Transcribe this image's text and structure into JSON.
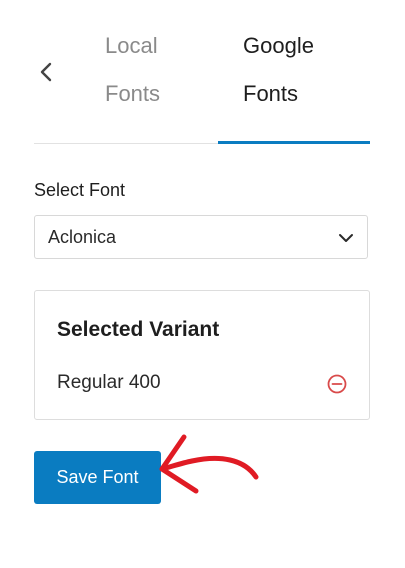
{
  "tabs": [
    {
      "line1": "Local",
      "line2": "Fonts",
      "active": false
    },
    {
      "line1": "Google",
      "line2": "Fonts",
      "active": true
    }
  ],
  "icons": {
    "back": "chevron-left-icon",
    "select": "chevron-down-icon",
    "remove": "minus-circle-icon",
    "annotation": "arrow-annotation-icon"
  },
  "select_font": {
    "label": "Select Font",
    "value": "Aclonica"
  },
  "selected_variant": {
    "title": "Selected Variant",
    "variants": [
      "Regular 400"
    ]
  },
  "save_button": {
    "label": "Save Font"
  },
  "colors": {
    "accent": "#0a7cc1",
    "remove": "#d94a4a",
    "annotation_arrow": "#e01b24",
    "inactive_tab": "#8a8a8a"
  }
}
